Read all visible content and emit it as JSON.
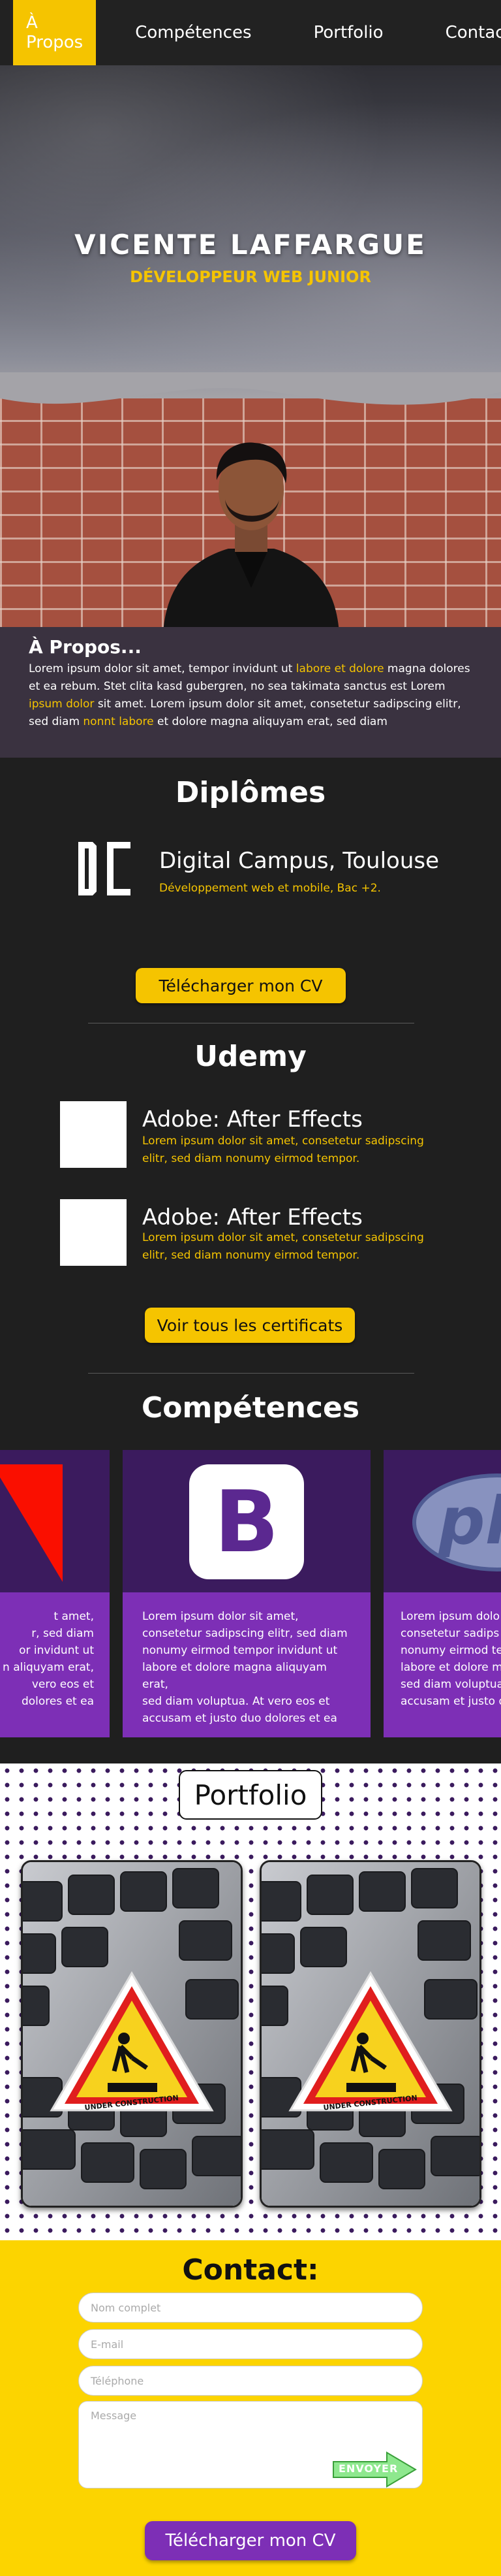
{
  "nav": {
    "items": [
      {
        "label": "À Propos"
      },
      {
        "label": "Compétences"
      },
      {
        "label": "Portfolio"
      },
      {
        "label": "Contact"
      }
    ]
  },
  "hero": {
    "name": "VICENTE LAFFARGUE",
    "subtitle": "DÉVELOPPEUR WEB JUNIOR"
  },
  "about": {
    "title": "À Propos...",
    "text_1": "Lorem ipsum dolor sit amet, tempor invidunt ut ",
    "hl_1": "labore et dolore",
    "text_2": " magna dolores et ea rebum. Stet clita kasd gubergren, no sea takimata sanctus est Lorem ",
    "hl_2": "ipsum dolor",
    "text_3": " sit amet. Lorem ipsum dolor sit amet, consetetur sadipscing elitr, sed diam ",
    "hl_3": "nonnt labore",
    "text_4": " et dolore magna aliquyam erat, sed diam"
  },
  "diplomes": {
    "title": "Diplômes",
    "school": "Digital Campus, Toulouse",
    "degree": "Développement web et mobile, Bac +2.",
    "cv_button": "Télécharger mon CV"
  },
  "udemy": {
    "title": "Udemy",
    "certs": [
      {
        "title": "Adobe: After Effects",
        "desc": "Lorem ipsum dolor sit amet, consetetur sadipscing elitr, sed diam nonumy eirmod tempor."
      },
      {
        "title": "Adobe: After Effects",
        "desc": "Lorem ipsum dolor sit amet, consetetur sadipscing elitr, sed diam nonumy eirmod tempor."
      }
    ],
    "all_button": "Voir tous les certificats"
  },
  "skills": {
    "title": "Compétences",
    "cards": [
      {
        "text": "t amet, ...elitr, sed diam ...or invidunt ut ...n aliquyam erat, ...vero eos et ...dolores et ea",
        "lines": [
          "t amet,",
          "r, sed diam",
          "or invidunt ut",
          "n aliquyam erat,",
          "vero eos et",
          "dolores et ea"
        ]
      },
      {
        "lines": [
          "Lorem ipsum dolor sit amet,",
          "consetetur sadipscing elitr, sed diam",
          "nonumy eirmod tempor invidunt ut",
          "labore et dolore magna aliquyam erat,",
          "sed diam voluptua. At vero eos et",
          "accusam et justo duo dolores et ea"
        ]
      },
      {
        "lines": [
          "Lorem ipsum dolo",
          "consetetur sadips",
          "nonumy eirmod te",
          "labore et dolore m",
          "sed diam voluptua",
          "accusam et justo d"
        ]
      }
    ],
    "card_logos": [
      "adobe-logo",
      "bootstrap-logo",
      "php-logo"
    ],
    "bootstrap_letter": "B",
    "php_letters": "ph"
  },
  "portfolio": {
    "title": "Portfolio",
    "sign_text": "UNDER CONSTRUCTION"
  },
  "contact": {
    "title": "Contact:",
    "name_placeholder": "Nom complet",
    "email_placeholder": "E-mail",
    "phone_placeholder": "Téléphone",
    "message_placeholder": "Message",
    "send_label": "ENVOYER",
    "cv_button": "Télécharger mon CV"
  },
  "colors": {
    "accent": "#f5c400",
    "purple": "#7d2fb6",
    "dark_purple": "#3b1b5e",
    "background": "#1f1f1f"
  }
}
